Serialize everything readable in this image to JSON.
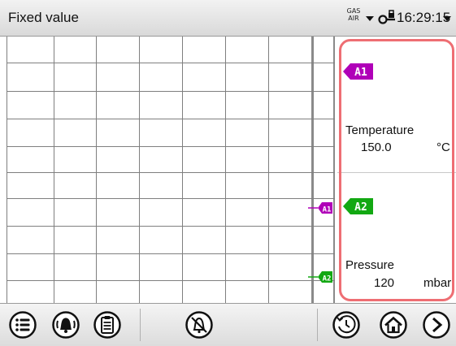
{
  "header": {
    "title": "Fixed value",
    "gas_label_top": "GAS",
    "gas_label_bottom": "AIR",
    "time": "16:29:15"
  },
  "chart": {
    "markers": [
      {
        "label": "A1",
        "color": "#b000b8"
      },
      {
        "label": "A2",
        "color": "#12a812"
      }
    ]
  },
  "panel": {
    "channels": [
      {
        "tag": "A1",
        "color": "#b000b8",
        "name": "Temperature",
        "value": "150.0",
        "unit": "°C"
      },
      {
        "tag": "A2",
        "color": "#12a812",
        "name": "Pressure",
        "value": "120",
        "unit": "mbar"
      }
    ],
    "highlight_color": "#ee6e73"
  },
  "footer": {
    "buttons": [
      {
        "name": "menu-button",
        "icon": "list-icon"
      },
      {
        "name": "alarm-button",
        "icon": "bell-alarm-icon"
      },
      {
        "name": "event-list-button",
        "icon": "clipboard-icon"
      },
      {
        "name": "acoustic-alarm-off-button",
        "icon": "bell-off-icon"
      },
      {
        "name": "timer-button",
        "icon": "clock-icon"
      },
      {
        "name": "home-button",
        "icon": "home-icon"
      },
      {
        "name": "next-button",
        "icon": "arrow-right-icon"
      }
    ]
  }
}
